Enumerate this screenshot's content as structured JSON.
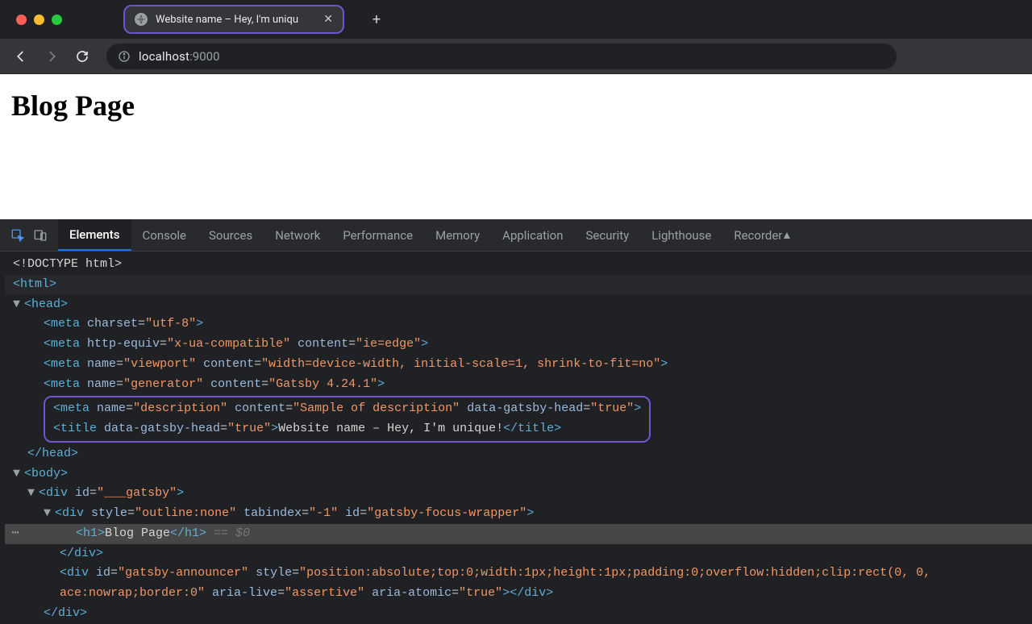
{
  "browser": {
    "tab_title": "Website name – Hey, I'm uniqu",
    "new_tab_glyph": "+",
    "address": {
      "host": "localhost",
      "port": ":9000"
    }
  },
  "page": {
    "h1": "Blog Page"
  },
  "devtools": {
    "tabs": [
      "Elements",
      "Console",
      "Sources",
      "Network",
      "Performance",
      "Memory",
      "Application",
      "Security",
      "Lighthouse",
      "Recorder"
    ],
    "active_tab": "Elements"
  },
  "dom": {
    "l0": "<!DOCTYPE html>",
    "l1": {
      "tag": "html"
    },
    "l2": {
      "tag": "head"
    },
    "metas": [
      {
        "raw": [
          [
            "tag",
            "<meta"
          ],
          [
            "sp",
            " "
          ],
          [
            "attr",
            "charset"
          ],
          [
            "eq",
            "="
          ],
          [
            "val",
            "\"utf-8\""
          ],
          [
            "tag",
            ">"
          ]
        ]
      },
      {
        "raw": [
          [
            "tag",
            "<meta"
          ],
          [
            "sp",
            " "
          ],
          [
            "attr",
            "http-equiv"
          ],
          [
            "eq",
            "="
          ],
          [
            "val",
            "\"x-ua-compatible\""
          ],
          [
            "sp",
            " "
          ],
          [
            "attr",
            "content"
          ],
          [
            "eq",
            "="
          ],
          [
            "val",
            "\"ie=edge\""
          ],
          [
            "tag",
            ">"
          ]
        ]
      },
      {
        "raw": [
          [
            "tag",
            "<meta"
          ],
          [
            "sp",
            " "
          ],
          [
            "attr",
            "name"
          ],
          [
            "eq",
            "="
          ],
          [
            "val",
            "\"viewport\""
          ],
          [
            "sp",
            " "
          ],
          [
            "attr",
            "content"
          ],
          [
            "eq",
            "="
          ],
          [
            "val",
            "\"width=device-width, initial-scale=1, shrink-to-fit=no\""
          ],
          [
            "tag",
            ">"
          ]
        ]
      },
      {
        "raw": [
          [
            "tag",
            "<meta"
          ],
          [
            "sp",
            " "
          ],
          [
            "attr",
            "name"
          ],
          [
            "eq",
            "="
          ],
          [
            "val",
            "\"generator\""
          ],
          [
            "sp",
            " "
          ],
          [
            "attr",
            "content"
          ],
          [
            "eq",
            "="
          ],
          [
            "val",
            "\"Gatsby 4.24.1\""
          ],
          [
            "tag",
            ">"
          ]
        ]
      }
    ],
    "boxed": {
      "a": [
        [
          "tag",
          "<meta"
        ],
        [
          "sp",
          " "
        ],
        [
          "attr",
          "name"
        ],
        [
          "eq",
          "="
        ],
        [
          "val",
          "\"description\""
        ],
        [
          "sp",
          " "
        ],
        [
          "attr",
          "content"
        ],
        [
          "eq",
          "="
        ],
        [
          "val",
          "\"Sample of description\""
        ],
        [
          "sp",
          " "
        ],
        [
          "attr",
          "data-gatsby-head"
        ],
        [
          "eq",
          "="
        ],
        [
          "val",
          "\"true\""
        ],
        [
          "tag",
          ">"
        ]
      ],
      "b": [
        [
          "tag",
          "<title"
        ],
        [
          "sp",
          " "
        ],
        [
          "attr",
          "data-gatsby-head"
        ],
        [
          "eq",
          "="
        ],
        [
          "val",
          "\"true\""
        ],
        [
          "tag",
          ">"
        ],
        [
          "txt",
          "Website name – Hey, I'm unique!"
        ],
        [
          "tag",
          "</title>"
        ]
      ]
    },
    "head_close": "</head>",
    "body_open": "body",
    "div_gatsby": [
      [
        "tag",
        "<div"
      ],
      [
        "sp",
        " "
      ],
      [
        "attr",
        "id"
      ],
      [
        "eq",
        "="
      ],
      [
        "val",
        "\"___gatsby\""
      ],
      [
        "tag",
        ">"
      ]
    ],
    "div_focus": [
      [
        "tag",
        "<div"
      ],
      [
        "sp",
        " "
      ],
      [
        "attr",
        "style"
      ],
      [
        "eq",
        "="
      ],
      [
        "val",
        "\"outline:none\""
      ],
      [
        "sp",
        " "
      ],
      [
        "attr",
        "tabindex"
      ],
      [
        "eq",
        "="
      ],
      [
        "val",
        "\"-1\""
      ],
      [
        "sp",
        " "
      ],
      [
        "attr",
        "id"
      ],
      [
        "eq",
        "="
      ],
      [
        "val",
        "\"gatsby-focus-wrapper\""
      ],
      [
        "tag",
        ">"
      ]
    ],
    "h1_line": {
      "open": "<h1>",
      "text": "Blog Page",
      "close": "</h1>",
      "marker": " == $0"
    },
    "focus_close": "</div>",
    "announcer1": [
      [
        "tag",
        "<div"
      ],
      [
        "sp",
        " "
      ],
      [
        "attr",
        "id"
      ],
      [
        "eq",
        "="
      ],
      [
        "val",
        "\"gatsby-announcer\""
      ],
      [
        "sp",
        " "
      ],
      [
        "attr",
        "style"
      ],
      [
        "eq",
        "="
      ],
      [
        "val",
        "\"position:absolute;top:0;width:1px;height:1px;padding:0;overflow:hidden;clip:rect(0, 0,"
      ]
    ],
    "announcer2": [
      [
        "val",
        "ace:nowrap;border:0\""
      ],
      [
        "sp",
        " "
      ],
      [
        "attr",
        "aria-live"
      ],
      [
        "eq",
        "="
      ],
      [
        "val",
        "\"assertive\""
      ],
      [
        "sp",
        " "
      ],
      [
        "attr",
        "aria-atomic"
      ],
      [
        "eq",
        "="
      ],
      [
        "val",
        "\"true\""
      ],
      [
        "tag",
        ">"
      ],
      [
        "tag",
        "</div>"
      ]
    ],
    "gatsby_close": "</div>"
  }
}
